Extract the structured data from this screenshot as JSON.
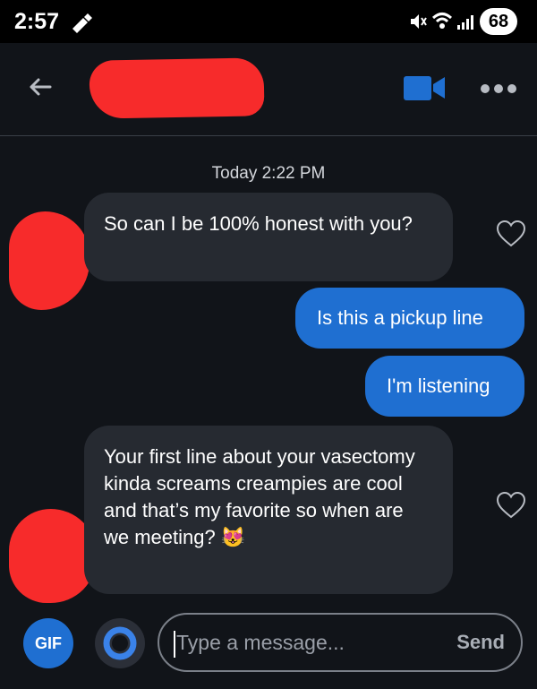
{
  "status_bar": {
    "time": "2:57",
    "battery": "68"
  },
  "conversation": {
    "date_separator": "Today 2:22 PM",
    "messages": [
      {
        "direction": "incoming",
        "text": "So can I be 100% honest with you?"
      },
      {
        "direction": "outgoing",
        "text": "Is this a pickup line"
      },
      {
        "direction": "outgoing",
        "text": "I'm listening"
      },
      {
        "direction": "incoming",
        "text": "Your first line about your vasectomy kinda screams creampies are cool and that’s my favorite so when are we meeting? 😻"
      }
    ]
  },
  "composer": {
    "gif_label": "GIF",
    "placeholder": "Type a message...",
    "send_label": "Send"
  },
  "colors": {
    "background": "#111419",
    "incoming_bubble": "#262a31",
    "outgoing_bubble": "#1f6fd1",
    "redaction": "#f72b2b"
  },
  "icons": {
    "back": "arrow-left-icon",
    "video": "video-camera-icon",
    "more": "more-dots-icon",
    "like": "heart-outline-icon",
    "mute": "mute-icon",
    "wifi": "wifi-icon",
    "signal": "signal-bars-icon"
  }
}
